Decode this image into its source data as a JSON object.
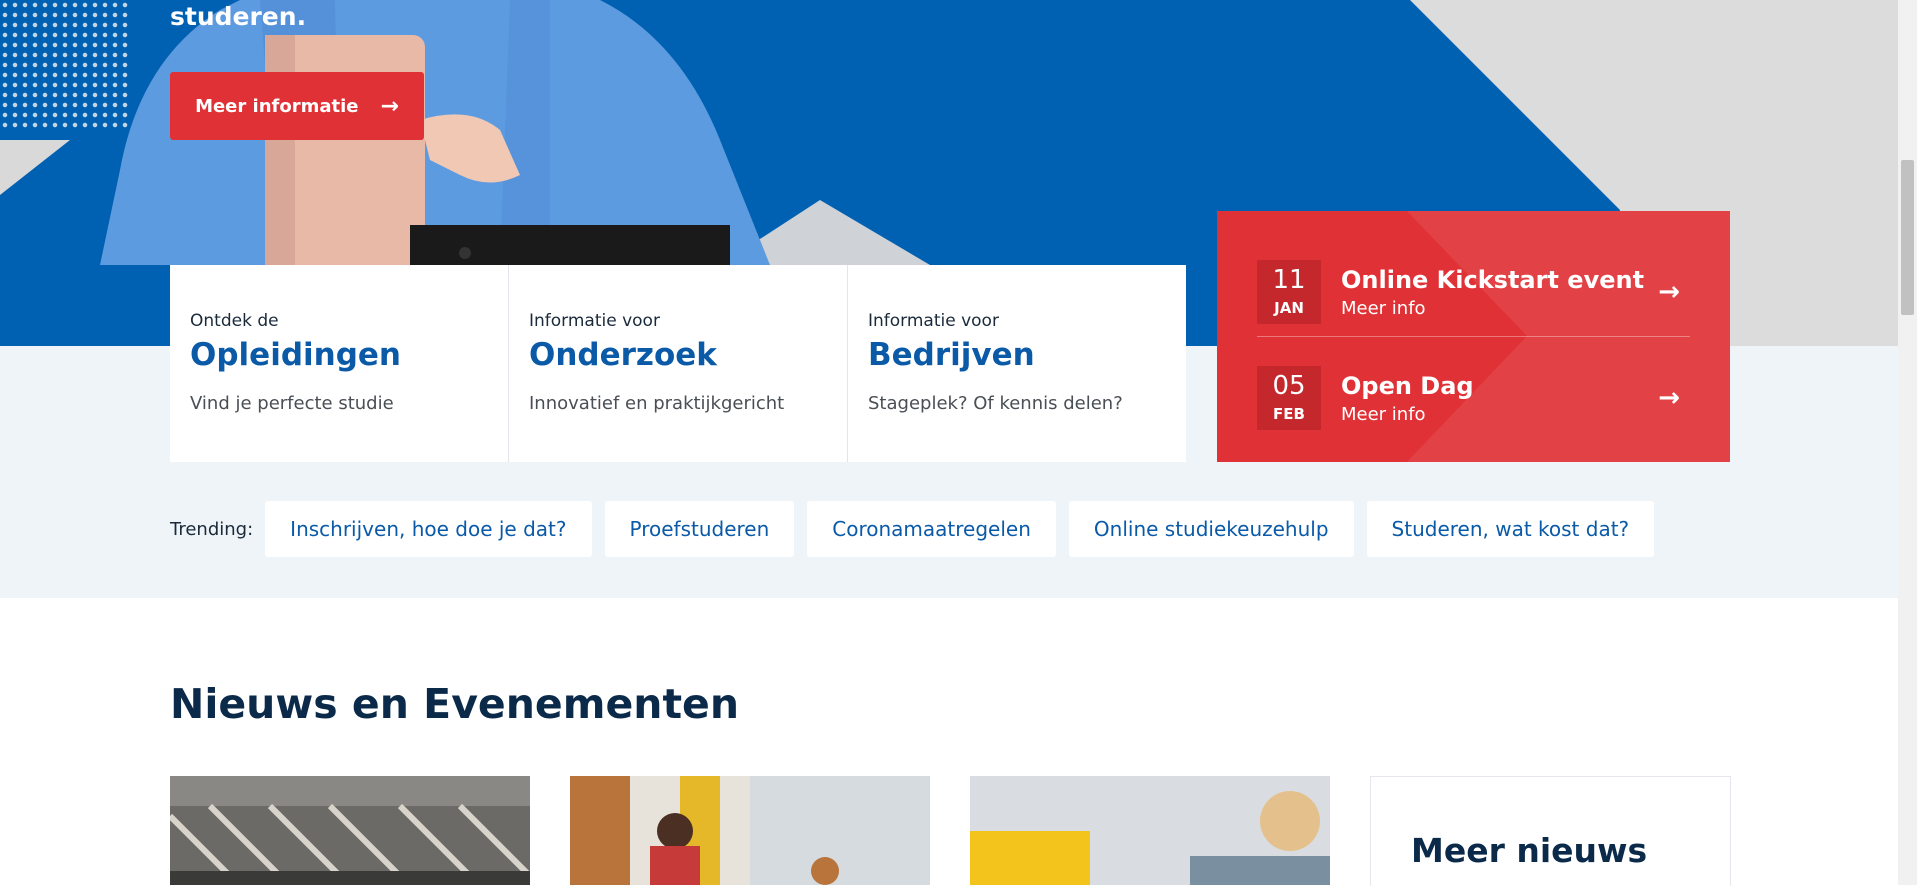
{
  "hero": {
    "text": "studeren.",
    "cta_label": "Meer informatie",
    "cta_icon": "arrow-right-icon"
  },
  "cards": [
    {
      "pre": "Ontdek de",
      "title": "Opleidingen",
      "desc": "Vind je perfecte studie"
    },
    {
      "pre": "Informatie voor",
      "title": "Onderzoek",
      "desc": "Innovatief en praktijkgericht"
    },
    {
      "pre": "Informatie voor",
      "title": "Bedrijven",
      "desc": "Stageplek? Of kennis delen?"
    }
  ],
  "events": [
    {
      "day": "11",
      "month": "JAN",
      "name": "Online Kickstart event",
      "more": "Meer info"
    },
    {
      "day": "05",
      "month": "FEB",
      "name": "Open Dag",
      "more": "Meer info"
    }
  ],
  "trending": {
    "label": "Trending:",
    "items": [
      "Inschrijven, hoe doe je dat?",
      "Proefstuderen",
      "Coronamaatregelen",
      "Online studiekeuzehulp",
      "Studeren, wat kost dat?"
    ]
  },
  "news": {
    "title": "Nieuws en Evenementen",
    "more_title": "Meer nieuws"
  },
  "colors": {
    "brand_blue": "#0060b2",
    "accent_red": "#e03236",
    "title_blue": "#0a5aa8"
  }
}
